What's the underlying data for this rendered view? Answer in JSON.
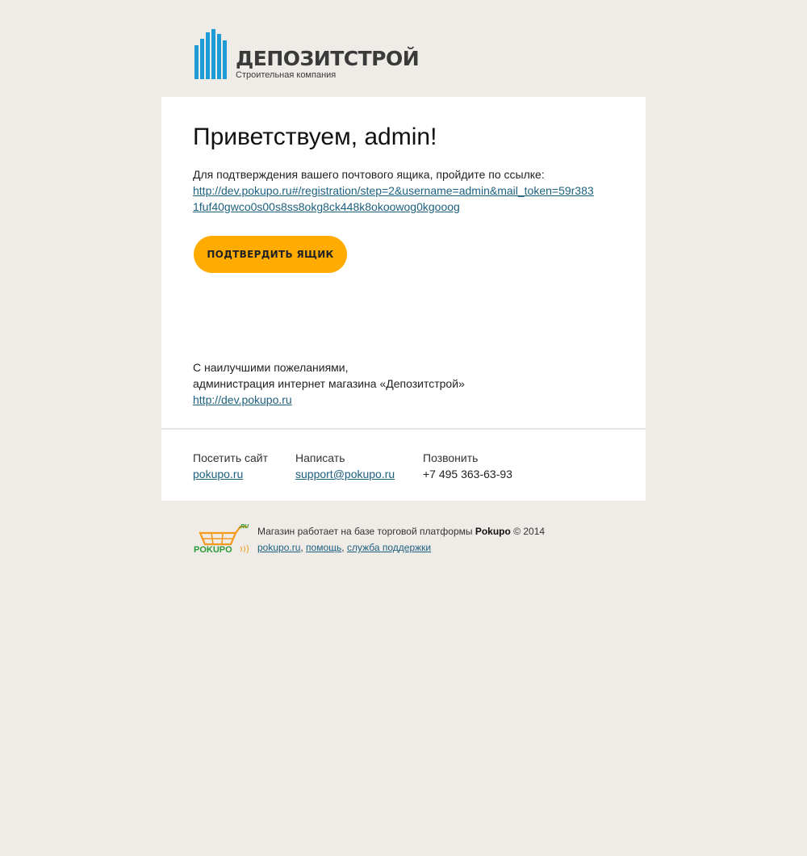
{
  "header": {
    "brand_name": "ДЕПОЗИТСТРОЙ",
    "brand_tagline": "Строительная компания",
    "brand_color": "#1e9ad4"
  },
  "message": {
    "greeting": "Приветствуем, admin!",
    "intro_text": "Для подтверждения вашего почтового ящика, пройдите по ссылке:",
    "confirm_link": "http://dev.pokupo.ru#/registration/step=2&username=admin&mail_token=59r3831fuf40gwco0s00s8ss8okg8ck448k8okoowog0kgooog",
    "confirm_button": "ПОДТВЕРДИТЬ ЯЩИК",
    "button_color": "#ffab00"
  },
  "signature": {
    "line1": "С наилучшими пожеланиями,",
    "line2": "администрация интернет магазина «Депозитстрой»",
    "link": "http://dev.pokupo.ru"
  },
  "contacts": {
    "visit": {
      "label": "Посетить сайт",
      "value": "pokupo.ru"
    },
    "write": {
      "label": "Написать",
      "value": "support@pokupo.ru"
    },
    "call": {
      "label": "Позвонить",
      "value": "+7 495 363-63-93"
    }
  },
  "footer": {
    "logo_text": "POKUPO",
    "logo_suffix": ".RU",
    "platform_text": "Магазин работает на базе торговой платформы",
    "platform_name": "Pokupo",
    "copyright": "© 2014",
    "links": [
      "pokupo.ru",
      "помощь",
      "служба поддержки"
    ]
  },
  "link_color": "#1c5f7f"
}
